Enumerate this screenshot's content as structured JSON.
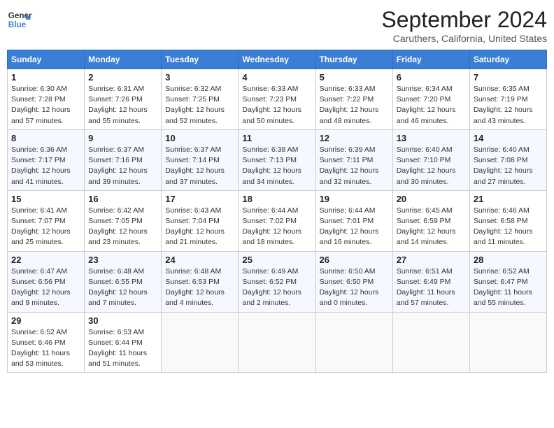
{
  "header": {
    "logo_line1": "General",
    "logo_line2": "Blue",
    "month": "September 2024",
    "location": "Caruthers, California, United States"
  },
  "weekdays": [
    "Sunday",
    "Monday",
    "Tuesday",
    "Wednesday",
    "Thursday",
    "Friday",
    "Saturday"
  ],
  "weeks": [
    [
      {
        "day": "1",
        "info": "Sunrise: 6:30 AM\nSunset: 7:28 PM\nDaylight: 12 hours\nand 57 minutes."
      },
      {
        "day": "2",
        "info": "Sunrise: 6:31 AM\nSunset: 7:26 PM\nDaylight: 12 hours\nand 55 minutes."
      },
      {
        "day": "3",
        "info": "Sunrise: 6:32 AM\nSunset: 7:25 PM\nDaylight: 12 hours\nand 52 minutes."
      },
      {
        "day": "4",
        "info": "Sunrise: 6:33 AM\nSunset: 7:23 PM\nDaylight: 12 hours\nand 50 minutes."
      },
      {
        "day": "5",
        "info": "Sunrise: 6:33 AM\nSunset: 7:22 PM\nDaylight: 12 hours\nand 48 minutes."
      },
      {
        "day": "6",
        "info": "Sunrise: 6:34 AM\nSunset: 7:20 PM\nDaylight: 12 hours\nand 46 minutes."
      },
      {
        "day": "7",
        "info": "Sunrise: 6:35 AM\nSunset: 7:19 PM\nDaylight: 12 hours\nand 43 minutes."
      }
    ],
    [
      {
        "day": "8",
        "info": "Sunrise: 6:36 AM\nSunset: 7:17 PM\nDaylight: 12 hours\nand 41 minutes."
      },
      {
        "day": "9",
        "info": "Sunrise: 6:37 AM\nSunset: 7:16 PM\nDaylight: 12 hours\nand 39 minutes."
      },
      {
        "day": "10",
        "info": "Sunrise: 6:37 AM\nSunset: 7:14 PM\nDaylight: 12 hours\nand 37 minutes."
      },
      {
        "day": "11",
        "info": "Sunrise: 6:38 AM\nSunset: 7:13 PM\nDaylight: 12 hours\nand 34 minutes."
      },
      {
        "day": "12",
        "info": "Sunrise: 6:39 AM\nSunset: 7:11 PM\nDaylight: 12 hours\nand 32 minutes."
      },
      {
        "day": "13",
        "info": "Sunrise: 6:40 AM\nSunset: 7:10 PM\nDaylight: 12 hours\nand 30 minutes."
      },
      {
        "day": "14",
        "info": "Sunrise: 6:40 AM\nSunset: 7:08 PM\nDaylight: 12 hours\nand 27 minutes."
      }
    ],
    [
      {
        "day": "15",
        "info": "Sunrise: 6:41 AM\nSunset: 7:07 PM\nDaylight: 12 hours\nand 25 minutes."
      },
      {
        "day": "16",
        "info": "Sunrise: 6:42 AM\nSunset: 7:05 PM\nDaylight: 12 hours\nand 23 minutes."
      },
      {
        "day": "17",
        "info": "Sunrise: 6:43 AM\nSunset: 7:04 PM\nDaylight: 12 hours\nand 21 minutes."
      },
      {
        "day": "18",
        "info": "Sunrise: 6:44 AM\nSunset: 7:02 PM\nDaylight: 12 hours\nand 18 minutes."
      },
      {
        "day": "19",
        "info": "Sunrise: 6:44 AM\nSunset: 7:01 PM\nDaylight: 12 hours\nand 16 minutes."
      },
      {
        "day": "20",
        "info": "Sunrise: 6:45 AM\nSunset: 6:59 PM\nDaylight: 12 hours\nand 14 minutes."
      },
      {
        "day": "21",
        "info": "Sunrise: 6:46 AM\nSunset: 6:58 PM\nDaylight: 12 hours\nand 11 minutes."
      }
    ],
    [
      {
        "day": "22",
        "info": "Sunrise: 6:47 AM\nSunset: 6:56 PM\nDaylight: 12 hours\nand 9 minutes."
      },
      {
        "day": "23",
        "info": "Sunrise: 6:48 AM\nSunset: 6:55 PM\nDaylight: 12 hours\nand 7 minutes."
      },
      {
        "day": "24",
        "info": "Sunrise: 6:48 AM\nSunset: 6:53 PM\nDaylight: 12 hours\nand 4 minutes."
      },
      {
        "day": "25",
        "info": "Sunrise: 6:49 AM\nSunset: 6:52 PM\nDaylight: 12 hours\nand 2 minutes."
      },
      {
        "day": "26",
        "info": "Sunrise: 6:50 AM\nSunset: 6:50 PM\nDaylight: 12 hours\nand 0 minutes."
      },
      {
        "day": "27",
        "info": "Sunrise: 6:51 AM\nSunset: 6:49 PM\nDaylight: 11 hours\nand 57 minutes."
      },
      {
        "day": "28",
        "info": "Sunrise: 6:52 AM\nSunset: 6:47 PM\nDaylight: 11 hours\nand 55 minutes."
      }
    ],
    [
      {
        "day": "29",
        "info": "Sunrise: 6:52 AM\nSunset: 6:46 PM\nDaylight: 11 hours\nand 53 minutes."
      },
      {
        "day": "30",
        "info": "Sunrise: 6:53 AM\nSunset: 6:44 PM\nDaylight: 11 hours\nand 51 minutes."
      },
      {
        "day": "",
        "info": ""
      },
      {
        "day": "",
        "info": ""
      },
      {
        "day": "",
        "info": ""
      },
      {
        "day": "",
        "info": ""
      },
      {
        "day": "",
        "info": ""
      }
    ]
  ]
}
